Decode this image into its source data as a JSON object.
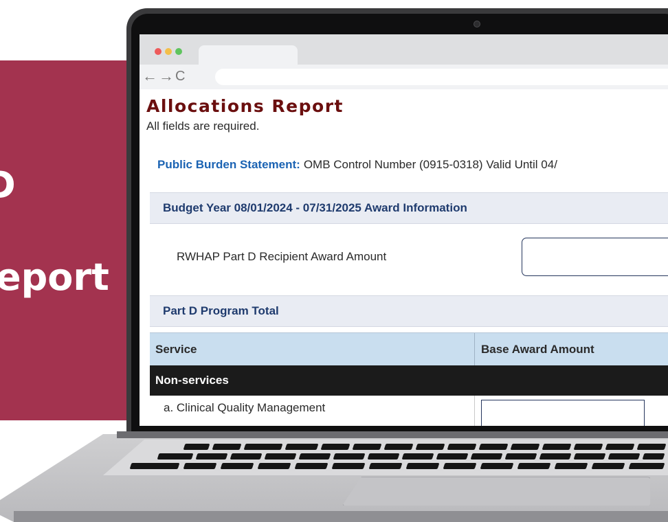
{
  "promo": {
    "line1": "D",
    "line2": "eport"
  },
  "browser": {
    "back_icon": "arrow-left",
    "forward_icon": "arrow-right",
    "reload_icon": "reload",
    "back_glyph": "←",
    "forward_glyph": "→",
    "reload_glyph": "C",
    "url": ""
  },
  "page": {
    "title": "Allocations Report",
    "subtitle": "All fields are required.",
    "burden_label": "Public Burden Statement:",
    "burden_text": "OMB Control Number (0915-0318) Valid Until 04/"
  },
  "award_section": {
    "heading": "Budget Year 08/01/2024 - 07/31/2025 Award Information",
    "field_label": "RWHAP Part D Recipient Award Amount",
    "field_value": ""
  },
  "program_section": {
    "heading": "Part D Program Total"
  },
  "table": {
    "columns": [
      "Service",
      "Base Award Amount"
    ],
    "group": "Non-services",
    "rows": [
      {
        "service": "a. Clinical Quality Management",
        "base_award": ""
      }
    ]
  },
  "colors": {
    "brand_maroon": "#a3334f",
    "title_red": "#6b0f0f",
    "link_blue": "#1b63b3",
    "section_bg": "#e9ecf3",
    "table_header": "#c9deef"
  }
}
